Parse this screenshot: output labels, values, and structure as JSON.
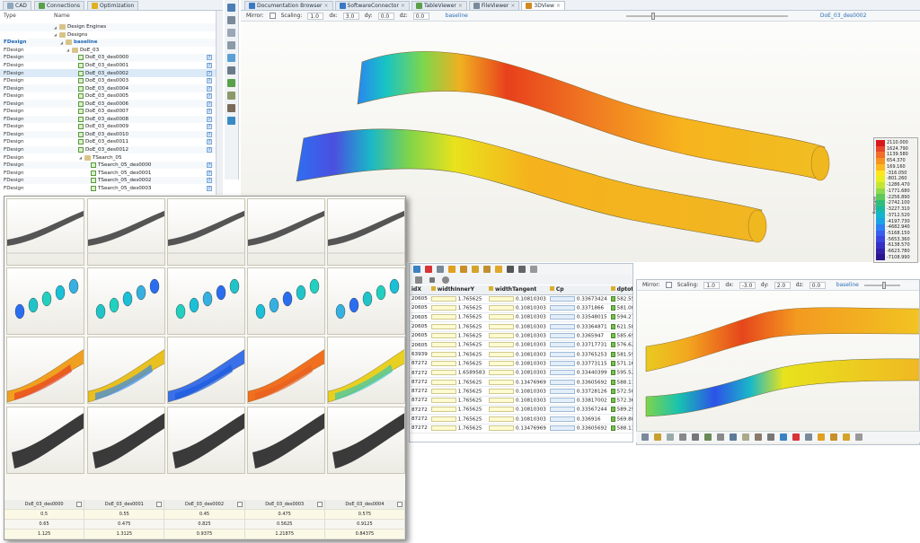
{
  "left_tabs": [
    {
      "label": "CAD",
      "icon": "cad-icon"
    },
    {
      "label": "Connections",
      "icon": "connections-icon"
    },
    {
      "label": "Optimization",
      "icon": "optimization-icon"
    }
  ],
  "right_tabs": [
    {
      "label": "Documentation Browser",
      "icon": "docs-icon",
      "active": false
    },
    {
      "label": "SoftwareConnector",
      "icon": "connector-icon",
      "active": false
    },
    {
      "label": "TableViewer",
      "icon": "table-icon",
      "active": false
    },
    {
      "label": "FileViewer",
      "icon": "file-icon",
      "active": false
    },
    {
      "label": "3DView",
      "icon": "view3d-icon",
      "active": true
    }
  ],
  "tree": {
    "col_type": "Type",
    "col_name": "Name",
    "rows": [
      {
        "type": "",
        "name": "Design Engines",
        "indent": 2,
        "kind": "folder",
        "q": false,
        "sel": false,
        "bold": false
      },
      {
        "type": "",
        "name": "Designs",
        "indent": 2,
        "kind": "folder",
        "q": false,
        "sel": false,
        "bold": false
      },
      {
        "type": "FDesign",
        "name": "baseline",
        "indent": 3,
        "kind": "folder",
        "q": false,
        "sel": false,
        "bold": true
      },
      {
        "type": "FDesign",
        "name": "DoE_03",
        "indent": 4,
        "kind": "folder",
        "q": false,
        "sel": false,
        "bold": false
      },
      {
        "type": "FDesign",
        "name": "DoE_03_des0000",
        "indent": 5,
        "kind": "check",
        "q": true,
        "sel": false,
        "bold": false
      },
      {
        "type": "FDesign",
        "name": "DoE_03_des0001",
        "indent": 5,
        "kind": "check",
        "q": true,
        "sel": false,
        "bold": false
      },
      {
        "type": "FDesign",
        "name": "DoE_03_des0002",
        "indent": 5,
        "kind": "check",
        "q": true,
        "sel": true,
        "bold": false
      },
      {
        "type": "FDesign",
        "name": "DoE_03_des0003",
        "indent": 5,
        "kind": "check",
        "q": true,
        "sel": false,
        "bold": false
      },
      {
        "type": "FDesign",
        "name": "DoE_03_des0004",
        "indent": 5,
        "kind": "check",
        "q": true,
        "sel": false,
        "bold": false
      },
      {
        "type": "FDesign",
        "name": "DoE_03_des0005",
        "indent": 5,
        "kind": "check",
        "q": true,
        "sel": false,
        "bold": false
      },
      {
        "type": "FDesign",
        "name": "DoE_03_des0006",
        "indent": 5,
        "kind": "check",
        "q": true,
        "sel": false,
        "bold": false
      },
      {
        "type": "FDesign",
        "name": "DoE_03_des0007",
        "indent": 5,
        "kind": "check",
        "q": true,
        "sel": false,
        "bold": false
      },
      {
        "type": "FDesign",
        "name": "DoE_03_des0008",
        "indent": 5,
        "kind": "check",
        "q": true,
        "sel": false,
        "bold": false
      },
      {
        "type": "FDesign",
        "name": "DoE_03_des0009",
        "indent": 5,
        "kind": "check",
        "q": true,
        "sel": false,
        "bold": false
      },
      {
        "type": "FDesign",
        "name": "DoE_03_des0010",
        "indent": 5,
        "kind": "check",
        "q": true,
        "sel": false,
        "bold": false
      },
      {
        "type": "FDesign",
        "name": "DoE_03_des0011",
        "indent": 5,
        "kind": "check",
        "q": true,
        "sel": false,
        "bold": false
      },
      {
        "type": "FDesign",
        "name": "DoE_03_des0012",
        "indent": 5,
        "kind": "check",
        "q": true,
        "sel": false,
        "bold": false
      },
      {
        "type": "FDesign",
        "name": "TSearch_05",
        "indent": 6,
        "kind": "folder",
        "q": false,
        "sel": false,
        "bold": false
      },
      {
        "type": "FDesign",
        "name": "TSearch_05_des0000",
        "indent": 7,
        "kind": "check",
        "q": true,
        "sel": false,
        "bold": false
      },
      {
        "type": "FDesign",
        "name": "TSearch_05_des0001",
        "indent": 7,
        "kind": "check",
        "q": true,
        "sel": false,
        "bold": false
      },
      {
        "type": "FDesign",
        "name": "TSearch_05_des0002",
        "indent": 7,
        "kind": "check",
        "q": true,
        "sel": false,
        "bold": false
      },
      {
        "type": "FDesign",
        "name": "TSearch_05_des0003",
        "indent": 7,
        "kind": "check",
        "q": true,
        "sel": false,
        "bold": false
      }
    ]
  },
  "view_main": {
    "mirror_label": "Mirror:",
    "scaling_label": "Scaling:",
    "scaling": "1.0",
    "dx_label": "dx:",
    "dx": "3.0",
    "dy_label": "dy:",
    "dy": "0.0",
    "dz_label": "dz:",
    "dz": "0.0",
    "left_design": "baseline",
    "right_design": "DoE_03_des0002"
  },
  "legend": {
    "title": "Pressure",
    "values": [
      "2110.000",
      "1624.790",
      "1139.580",
      "654.370",
      "169.160",
      "-316.050",
      "-801.260",
      "-1286.470",
      "-1771.680",
      "-2256.890",
      "-2742.100",
      "-3227.310",
      "-3712.520",
      "-4197.730",
      "-4682.940",
      "-5168.150",
      "-5653.360",
      "-6138.570",
      "-6623.780",
      "-7108.990"
    ],
    "colors": [
      "#d7191c",
      "#e8452a",
      "#f26e2a",
      "#f7941d",
      "#fbb91d",
      "#fde61d",
      "#e8ee1f",
      "#c3e635",
      "#8fd94a",
      "#5cc95a",
      "#2fbe7a",
      "#18b9a4",
      "#14b5cc",
      "#1aa3e6",
      "#2e7ef1",
      "#3a5df1",
      "#3b45de",
      "#3631c4",
      "#3220a8",
      "#2b158e"
    ]
  },
  "table": {
    "headers": [
      "idX",
      "widthInnerY",
      "widthTangent",
      "Cp",
      "dptot"
    ],
    "rows": [
      [
        "20605",
        "1.765625",
        "0.10810303",
        "0.33673424",
        "582.55356"
      ],
      [
        "20605",
        "1.765625",
        "0.10810303",
        "0.3371866",
        "581.00049"
      ],
      [
        "20605",
        "1.765625",
        "0.10810303",
        "0.33548015",
        "594.27734"
      ],
      [
        "20605",
        "1.765625",
        "0.10810303",
        "0.33364871",
        "621.58838"
      ],
      [
        "20605",
        "1.765625",
        "0.10810303",
        "0.3365947",
        "585.69336"
      ],
      [
        "20605",
        "1.765625",
        "0.10810303",
        "0.33717731",
        "576.62598"
      ],
      [
        "63939",
        "1.765625",
        "0.10810303",
        "0.33765253",
        "581.59863"
      ],
      [
        "87272",
        "1.765625",
        "0.10810303",
        "0.33773115",
        "571.16943"
      ],
      [
        "87272",
        "1.6589583",
        "0.10810303",
        "0.33440399",
        "595.52539"
      ],
      [
        "87272",
        "1.765625",
        "0.13476969",
        "0.33605692",
        "588.11279"
      ],
      [
        "87272",
        "1.765625",
        "0.10810303",
        "0.33728126",
        "572.50781"
      ],
      [
        "87272",
        "1.765625",
        "0.10810303",
        "0.33817002",
        "572.36377"
      ],
      [
        "87272",
        "1.765625",
        "0.10810303",
        "0.33567244",
        "589.2915"
      ],
      [
        "87272",
        "1.765625",
        "0.10810303",
        "0.336916",
        "569.88672"
      ],
      [
        "87272",
        "1.765625",
        "0.13476969",
        "0.33605692",
        "588.11279"
      ]
    ]
  },
  "view_second": {
    "mirror_label": "Mirror:",
    "scaling_label": "Scaling:",
    "scaling": "1.0",
    "dx_label": "dx:",
    "dx": "-3.0",
    "dy_label": "dy:",
    "dy": "2.0",
    "dz_label": "dz:",
    "dz": "0.0",
    "design": "baseline"
  },
  "gallery": {
    "columns": [
      "DoE_03_des0000",
      "DoE_03_des0001",
      "DoE_03_des0002",
      "DoE_03_des0003",
      "DoE_03_des0004"
    ],
    "value_rows": [
      [
        "0.5",
        "0.55",
        "0.45",
        "0.475",
        "0.575"
      ],
      [
        "0.65",
        "0.475",
        "0.825",
        "0.5625",
        "0.9125"
      ],
      [
        "1.125",
        "1.3125",
        "0.9375",
        "1.21875",
        "0.84375"
      ]
    ]
  }
}
